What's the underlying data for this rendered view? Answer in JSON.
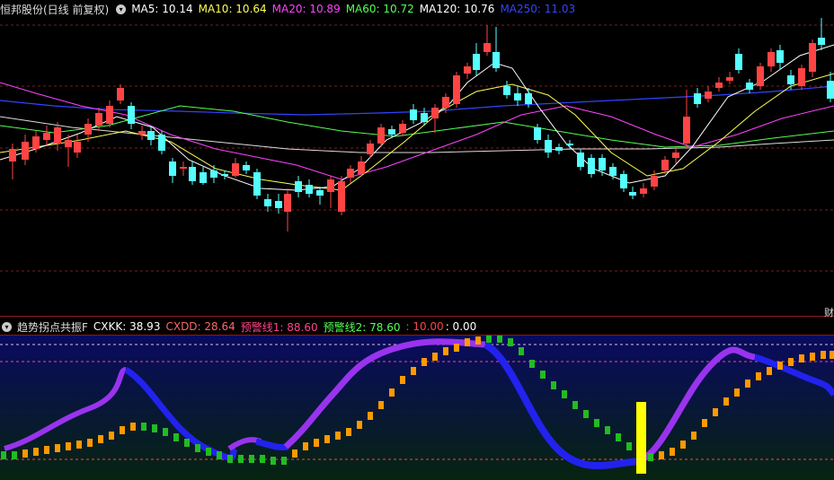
{
  "main": {
    "stock_title": "恒邦股份(日线 前复权)",
    "ma": [
      {
        "label": "MA5: 10.14",
        "color": "#ffffff"
      },
      {
        "label": "MA10: 10.64",
        "color": "#ffff55"
      },
      {
        "label": "MA20: 10.89",
        "color": "#ff44ff"
      },
      {
        "label": "MA60: 10.72",
        "color": "#55ff55"
      },
      {
        "label": "MA120: 10.76",
        "color": "#ffffff"
      },
      {
        "label": "MA250: 11.03",
        "color": "#3344ff"
      }
    ],
    "side_label": "财"
  },
  "sub": {
    "indicator_title": "趋势拐点共振F",
    "items": [
      {
        "label": "CXKK: 38.93",
        "color": "#ffffff"
      },
      {
        "label": "CXDD: 28.64",
        "color": "#ff6666"
      },
      {
        "label": "预警线1: 88.60",
        "color": "#ff4488"
      },
      {
        "label": "预警线2: 78.60",
        "color": "#55ff55"
      },
      {
        "label": ": 10.00",
        "color": "#ff4444"
      },
      {
        "label": ": 0.00",
        "color": "#ffffff"
      }
    ]
  },
  "colors": {
    "up": "#ff4444",
    "down": "#55ffff",
    "separator": "#8b1a1a"
  }
}
